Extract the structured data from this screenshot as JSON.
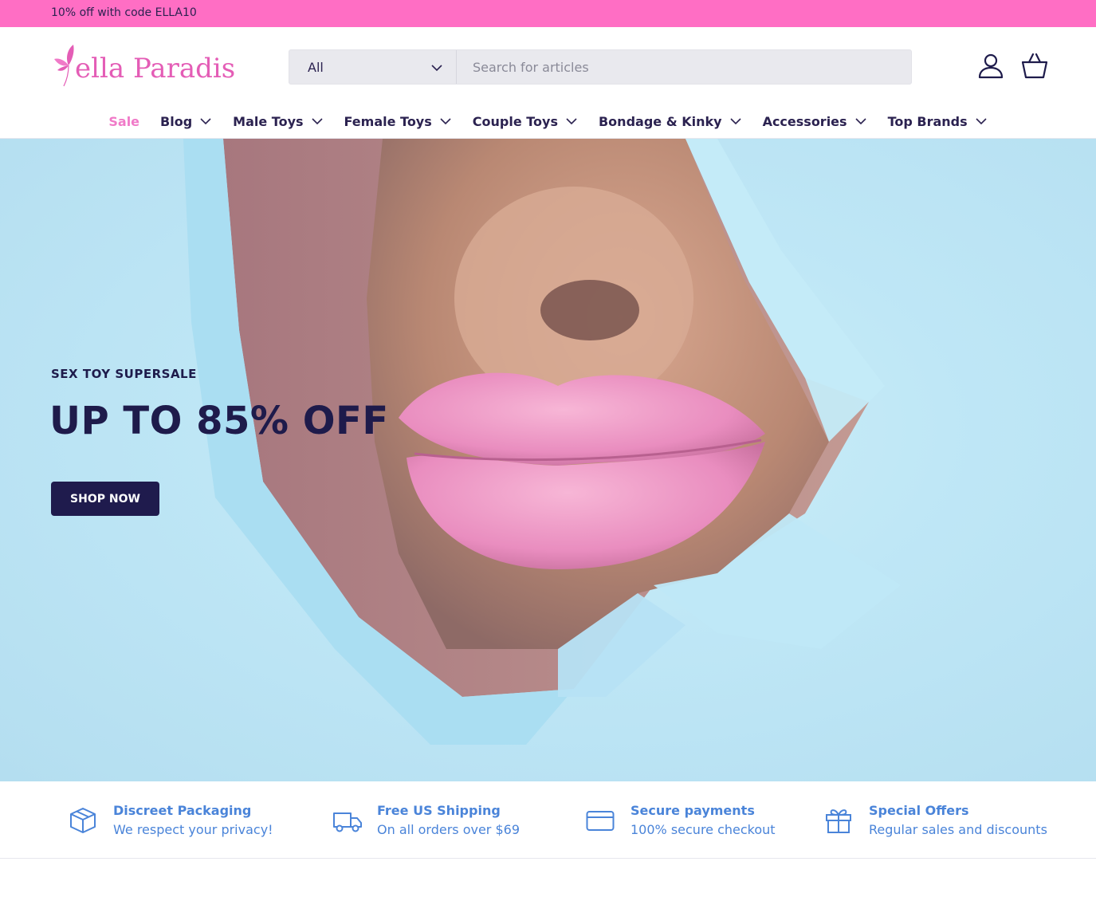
{
  "announcement": {
    "text": "10% off with code ELLA10"
  },
  "colors": {
    "brand_pink": "#ff6ec4",
    "navy": "#1f1b4d",
    "feature_blue": "#4a84d9",
    "sale_pink": "#f07ac8"
  },
  "header": {
    "logo_text": "ella Paradis",
    "search": {
      "category_selected": "All",
      "placeholder": "Search for articles"
    },
    "icons": [
      "account-icon",
      "basket-icon"
    ]
  },
  "nav": {
    "items": [
      {
        "label": "Sale",
        "has_dropdown": false
      },
      {
        "label": "Blog",
        "has_dropdown": true
      },
      {
        "label": "Male Toys",
        "has_dropdown": true
      },
      {
        "label": "Female Toys",
        "has_dropdown": true
      },
      {
        "label": "Couple Toys",
        "has_dropdown": true
      },
      {
        "label": "Bondage & Kinky",
        "has_dropdown": true
      },
      {
        "label": "Accessories",
        "has_dropdown": true
      },
      {
        "label": "Top Brands",
        "has_dropdown": true
      }
    ]
  },
  "hero": {
    "eyebrow": "SEX TOY SUPERSALE",
    "title": "UP TO 85% OFF",
    "button_label": "SHOP NOW"
  },
  "features": [
    {
      "icon": "box-icon",
      "title": "Discreet Packaging",
      "subtitle": "We respect your privacy!"
    },
    {
      "icon": "truck-icon",
      "title": "Free US Shipping",
      "subtitle": "On all orders over $69"
    },
    {
      "icon": "credit-card-icon",
      "title": "Secure payments",
      "subtitle": "100% secure checkout"
    },
    {
      "icon": "gift-icon",
      "title": "Special Offers",
      "subtitle": "Regular sales and discounts"
    }
  ]
}
